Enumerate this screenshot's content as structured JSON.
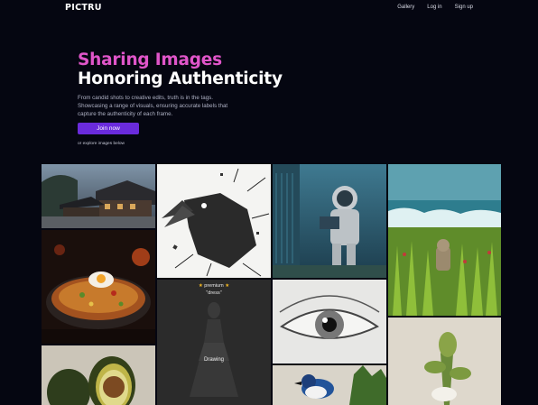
{
  "nav": {
    "logo": "PICTRU",
    "links": [
      {
        "label": "Gallery"
      },
      {
        "label": "Log in"
      },
      {
        "label": "Sign up"
      }
    ]
  },
  "hero": {
    "title_line1": "Sharing Images",
    "title_line2": "Honoring Authenticity",
    "description": "From candid shots to creative edits, truth is in the tags. Showcasing a range of visuals, ensuring accurate labels that capture the authenticity of each frame.",
    "cta": "Join now",
    "explore": "or explore images below"
  },
  "gallery": {
    "premium_tile": {
      "badge": "premium",
      "keyword": "\"dress\"",
      "tag": "Drawing",
      "star": "★"
    }
  },
  "colors": {
    "background": "#050611",
    "accent_pink": "#e055c9",
    "button_purple": "#6a2bdc"
  }
}
